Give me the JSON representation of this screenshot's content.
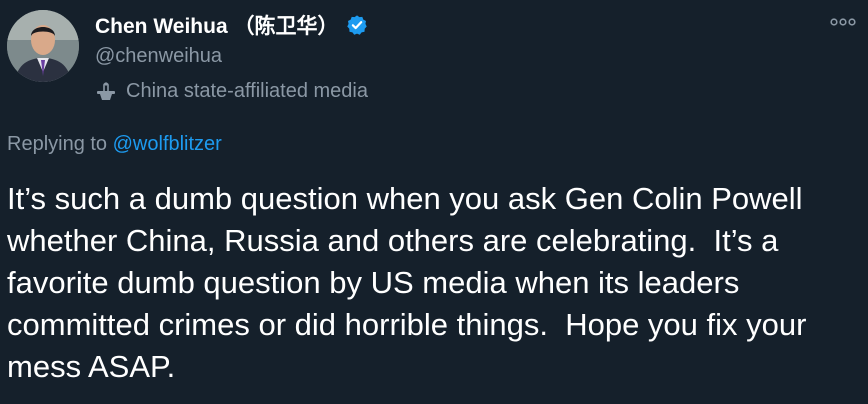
{
  "author": {
    "display_name": "Chen Weihua （陈卫华）",
    "handle": "@chenweihua",
    "verified": true,
    "label": "China state-affiliated media",
    "label_icon": "podium-icon",
    "avatar": "avatar"
  },
  "reply": {
    "prefix": "Replying to ",
    "mention": "@wolfblitzer"
  },
  "tweet": {
    "text": "It’s such a dumb question when you ask Gen Colin Powell whether China, Russia and others are celebrating.  It’s a favorite dumb question by US media when its leaders committed crimes or did horrible things.  Hope you fix your mess ASAP."
  },
  "more_icon": "more-icon",
  "colors": {
    "background": "#15202b",
    "text": "#ffffff",
    "secondary": "#8b98a5",
    "link": "#1d9bf0",
    "verified": "#1d9bf0"
  }
}
